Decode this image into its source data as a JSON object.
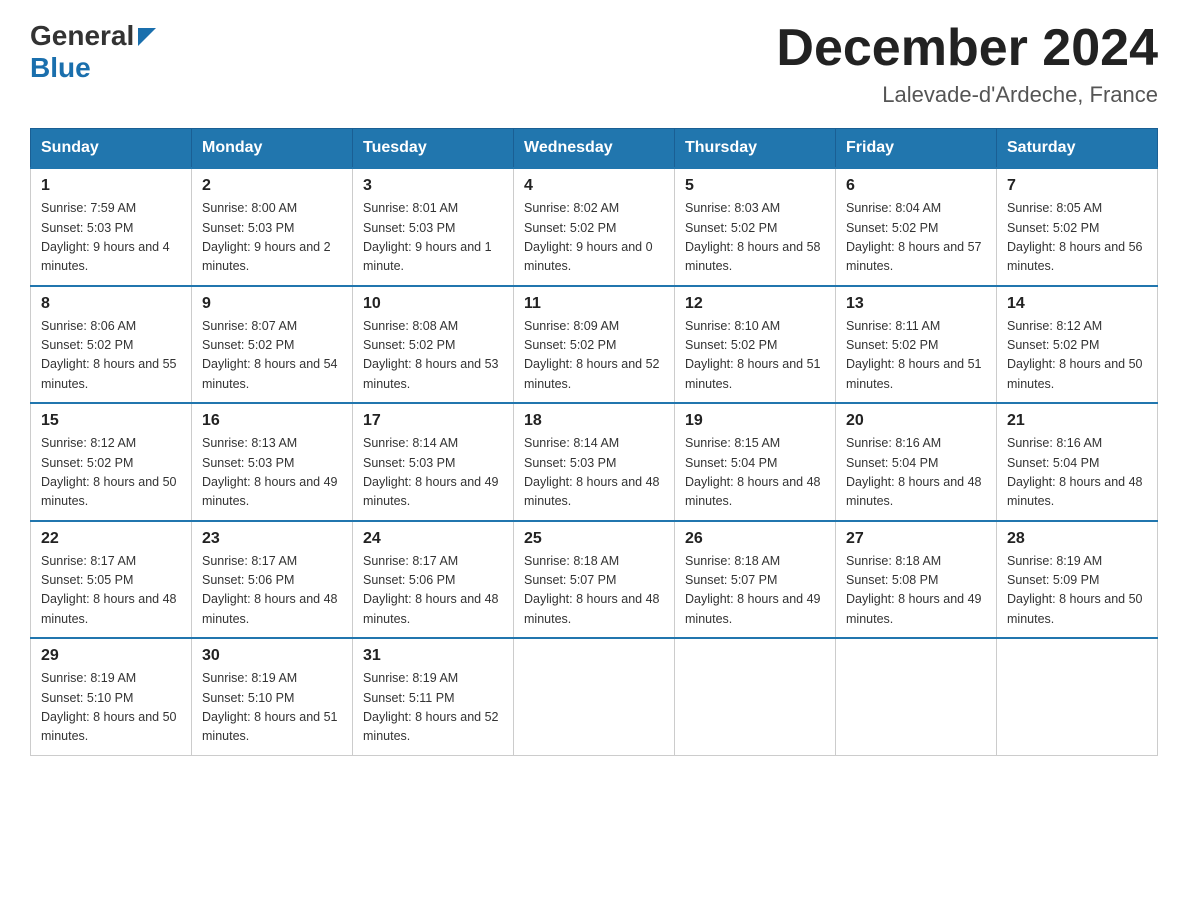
{
  "logo": {
    "general": "General",
    "blue": "Blue"
  },
  "header": {
    "title": "December 2024",
    "location": "Lalevade-d'Ardeche, France"
  },
  "weekdays": [
    "Sunday",
    "Monday",
    "Tuesday",
    "Wednesday",
    "Thursday",
    "Friday",
    "Saturday"
  ],
  "weeks": [
    [
      {
        "day": "1",
        "sunrise": "7:59 AM",
        "sunset": "5:03 PM",
        "daylight": "9 hours and 4 minutes."
      },
      {
        "day": "2",
        "sunrise": "8:00 AM",
        "sunset": "5:03 PM",
        "daylight": "9 hours and 2 minutes."
      },
      {
        "day": "3",
        "sunrise": "8:01 AM",
        "sunset": "5:03 PM",
        "daylight": "9 hours and 1 minute."
      },
      {
        "day": "4",
        "sunrise": "8:02 AM",
        "sunset": "5:02 PM",
        "daylight": "9 hours and 0 minutes."
      },
      {
        "day": "5",
        "sunrise": "8:03 AM",
        "sunset": "5:02 PM",
        "daylight": "8 hours and 58 minutes."
      },
      {
        "day": "6",
        "sunrise": "8:04 AM",
        "sunset": "5:02 PM",
        "daylight": "8 hours and 57 minutes."
      },
      {
        "day": "7",
        "sunrise": "8:05 AM",
        "sunset": "5:02 PM",
        "daylight": "8 hours and 56 minutes."
      }
    ],
    [
      {
        "day": "8",
        "sunrise": "8:06 AM",
        "sunset": "5:02 PM",
        "daylight": "8 hours and 55 minutes."
      },
      {
        "day": "9",
        "sunrise": "8:07 AM",
        "sunset": "5:02 PM",
        "daylight": "8 hours and 54 minutes."
      },
      {
        "day": "10",
        "sunrise": "8:08 AM",
        "sunset": "5:02 PM",
        "daylight": "8 hours and 53 minutes."
      },
      {
        "day": "11",
        "sunrise": "8:09 AM",
        "sunset": "5:02 PM",
        "daylight": "8 hours and 52 minutes."
      },
      {
        "day": "12",
        "sunrise": "8:10 AM",
        "sunset": "5:02 PM",
        "daylight": "8 hours and 51 minutes."
      },
      {
        "day": "13",
        "sunrise": "8:11 AM",
        "sunset": "5:02 PM",
        "daylight": "8 hours and 51 minutes."
      },
      {
        "day": "14",
        "sunrise": "8:12 AM",
        "sunset": "5:02 PM",
        "daylight": "8 hours and 50 minutes."
      }
    ],
    [
      {
        "day": "15",
        "sunrise": "8:12 AM",
        "sunset": "5:02 PM",
        "daylight": "8 hours and 50 minutes."
      },
      {
        "day": "16",
        "sunrise": "8:13 AM",
        "sunset": "5:03 PM",
        "daylight": "8 hours and 49 minutes."
      },
      {
        "day": "17",
        "sunrise": "8:14 AM",
        "sunset": "5:03 PM",
        "daylight": "8 hours and 49 minutes."
      },
      {
        "day": "18",
        "sunrise": "8:14 AM",
        "sunset": "5:03 PM",
        "daylight": "8 hours and 48 minutes."
      },
      {
        "day": "19",
        "sunrise": "8:15 AM",
        "sunset": "5:04 PM",
        "daylight": "8 hours and 48 minutes."
      },
      {
        "day": "20",
        "sunrise": "8:16 AM",
        "sunset": "5:04 PM",
        "daylight": "8 hours and 48 minutes."
      },
      {
        "day": "21",
        "sunrise": "8:16 AM",
        "sunset": "5:04 PM",
        "daylight": "8 hours and 48 minutes."
      }
    ],
    [
      {
        "day": "22",
        "sunrise": "8:17 AM",
        "sunset": "5:05 PM",
        "daylight": "8 hours and 48 minutes."
      },
      {
        "day": "23",
        "sunrise": "8:17 AM",
        "sunset": "5:06 PM",
        "daylight": "8 hours and 48 minutes."
      },
      {
        "day": "24",
        "sunrise": "8:17 AM",
        "sunset": "5:06 PM",
        "daylight": "8 hours and 48 minutes."
      },
      {
        "day": "25",
        "sunrise": "8:18 AM",
        "sunset": "5:07 PM",
        "daylight": "8 hours and 48 minutes."
      },
      {
        "day": "26",
        "sunrise": "8:18 AM",
        "sunset": "5:07 PM",
        "daylight": "8 hours and 49 minutes."
      },
      {
        "day": "27",
        "sunrise": "8:18 AM",
        "sunset": "5:08 PM",
        "daylight": "8 hours and 49 minutes."
      },
      {
        "day": "28",
        "sunrise": "8:19 AM",
        "sunset": "5:09 PM",
        "daylight": "8 hours and 50 minutes."
      }
    ],
    [
      {
        "day": "29",
        "sunrise": "8:19 AM",
        "sunset": "5:10 PM",
        "daylight": "8 hours and 50 minutes."
      },
      {
        "day": "30",
        "sunrise": "8:19 AM",
        "sunset": "5:10 PM",
        "daylight": "8 hours and 51 minutes."
      },
      {
        "day": "31",
        "sunrise": "8:19 AM",
        "sunset": "5:11 PM",
        "daylight": "8 hours and 52 minutes."
      },
      null,
      null,
      null,
      null
    ]
  ]
}
